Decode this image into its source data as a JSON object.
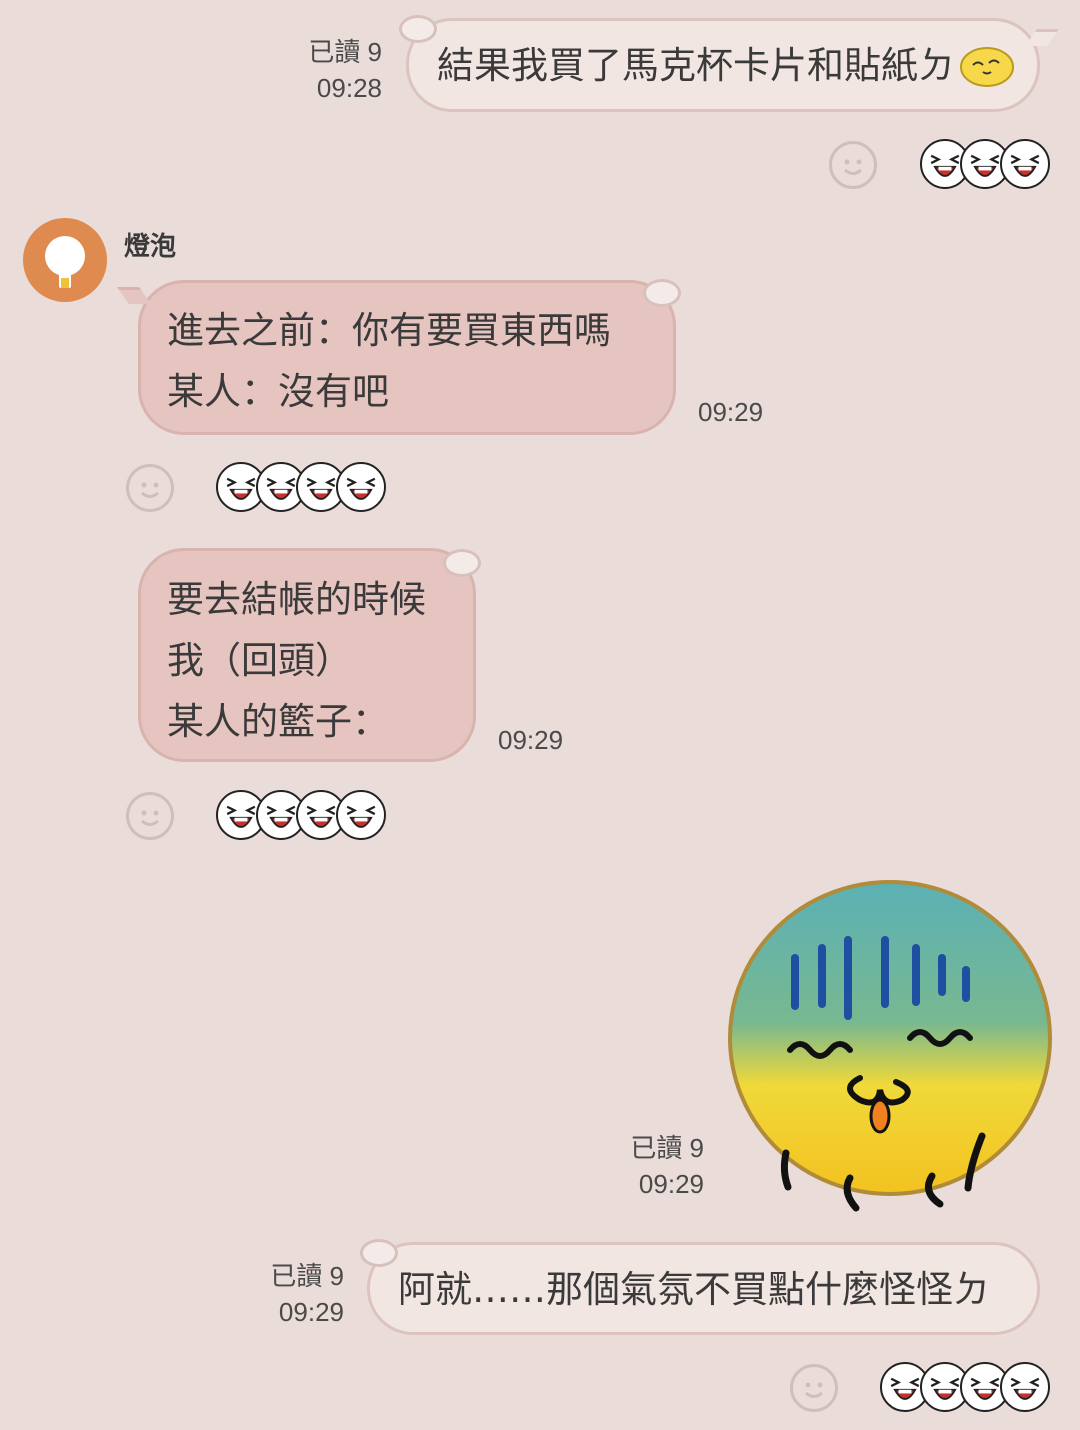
{
  "messages": {
    "m1": {
      "read_label": "已讀 9",
      "time": "09:28",
      "text": "結果我買了馬克杯卡片和貼紙ㄉ"
    },
    "m2": {
      "sender": "燈泡",
      "text": "進去之前：你有要買東西嗎\n某人：沒有吧",
      "time": "09:29"
    },
    "m3": {
      "text": "要去結帳的時候\n我（回頭）\n某人的籃子：",
      "time": "09:29"
    },
    "m4": {
      "read_label": "已讀 9",
      "time": "09:29",
      "sticker": "yellow-blue-blob-sticker"
    },
    "m5": {
      "read_label": "已讀 9",
      "time": "09:29",
      "text": "阿就……那個氣氛不買點什麼怪怪ㄉ"
    }
  },
  "reactions": {
    "r1": {
      "count": 3,
      "icon": "laughing-face-icon"
    },
    "r2": {
      "count": 4,
      "icon": "laughing-face-icon"
    },
    "r3": {
      "count": 4,
      "icon": "laughing-face-icon"
    },
    "r4": {
      "count": 4,
      "icon": "laughing-face-icon"
    }
  },
  "colors": {
    "background": "#e9dcd9",
    "outgoing_bubble": "#f2e6e3",
    "incoming_bubble": "#e6c4c0",
    "avatar": "#df8a4f"
  }
}
